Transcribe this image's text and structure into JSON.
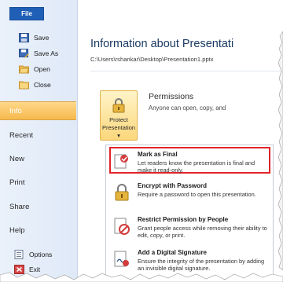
{
  "backstage": {
    "file_tab": "File",
    "commands": [
      {
        "label": "Save",
        "icon": "save-icon"
      },
      {
        "label": "Save As",
        "icon": "save-as-icon"
      },
      {
        "label": "Open",
        "icon": "open-folder-icon"
      },
      {
        "label": "Close",
        "icon": "close-folder-icon"
      }
    ],
    "nav": [
      {
        "label": "Info",
        "selected": true
      },
      {
        "label": "Recent"
      },
      {
        "label": "New"
      },
      {
        "label": "Print"
      },
      {
        "label": "Share"
      },
      {
        "label": "Help"
      },
      {
        "label": "Options"
      },
      {
        "label": "Exit"
      }
    ]
  },
  "info": {
    "title": "Information about Presentati",
    "path": "C:\\Users\\rshankar\\Desktop\\Presentation1.pptx",
    "permissions": {
      "button_line1": "Protect",
      "button_line2": "Presentation ▾",
      "heading": "Permissions",
      "description": "Anyone can open, copy, and"
    },
    "menu": [
      {
        "title": "Mark as Final",
        "description": "Let readers know the presentation is final and make it read-only.",
        "icon": "mark-final-icon"
      },
      {
        "title": "Encrypt with Password",
        "description": "Require a password to open this presentation.",
        "icon": "encrypt-lock-icon"
      },
      {
        "title": "Restrict Permission by People",
        "description": "Grant people access while removing their ability to edit, copy, or print.",
        "icon": "restrict-permission-icon"
      },
      {
        "title": "Add a Digital Signature",
        "description": "Ensure the integrity of the presentation by adding an invisible digital signature.",
        "icon": "digital-signature-icon"
      }
    ]
  },
  "colors": {
    "accent": "#1f5fb6",
    "selected": "#f6b94d",
    "highlight_border": "#e0242a"
  }
}
